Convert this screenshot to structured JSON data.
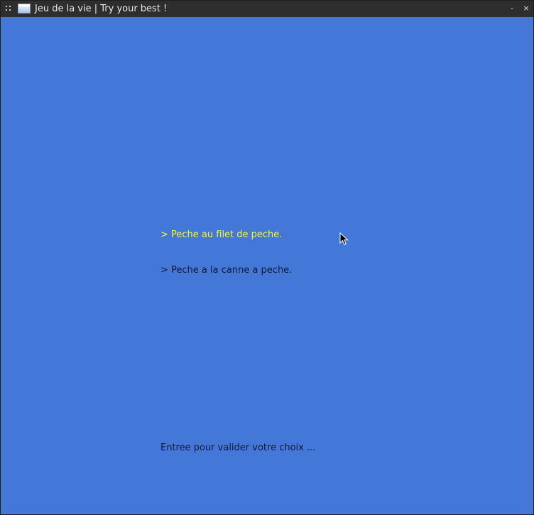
{
  "window": {
    "title": "Jeu de la vie | Try your best !",
    "minimize_label": "-",
    "close_label": "×"
  },
  "menu": {
    "items": [
      {
        "label": "> Peche au filet de peche.",
        "selected": true
      },
      {
        "label": "> Peche a la canne a peche.",
        "selected": false
      }
    ],
    "hint": "Entree pour valider votre choix ..."
  },
  "colors": {
    "background": "#4478d8",
    "selected_text": "#f5f542",
    "normal_text": "#101836",
    "titlebar": "#2e2e2e"
  },
  "icons": {
    "app": "window-app-icon",
    "grip": "grip-dots-icon",
    "cursor": "mouse-pointer-icon"
  }
}
